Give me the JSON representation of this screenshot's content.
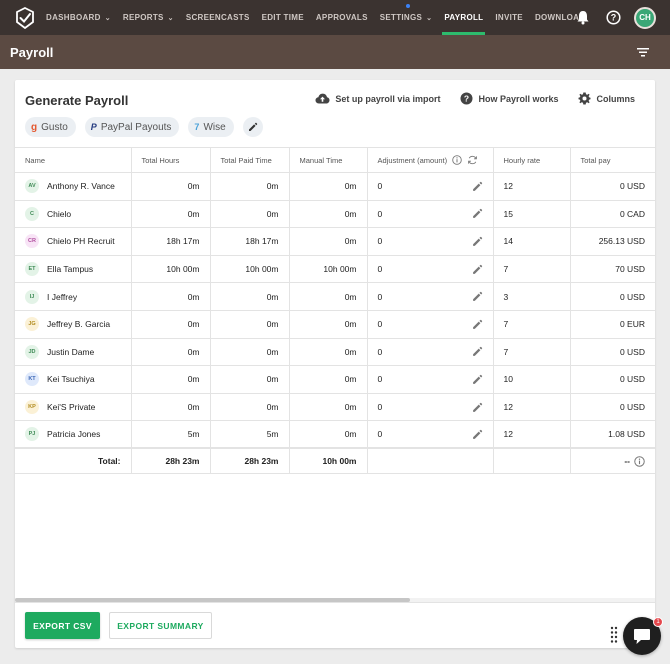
{
  "nav": {
    "items": [
      {
        "label": "DASHBOARD",
        "dropdown": true
      },
      {
        "label": "REPORTS",
        "dropdown": true
      },
      {
        "label": "SCREENCASTS",
        "dropdown": false
      },
      {
        "label": "EDIT TIME",
        "dropdown": false
      },
      {
        "label": "APPROVALS",
        "dropdown": false
      },
      {
        "label": "SETTINGS",
        "dropdown": true
      },
      {
        "label": "PAYROLL",
        "dropdown": false
      },
      {
        "label": "INVITE",
        "dropdown": false
      },
      {
        "label": "DOWNLOAD",
        "dropdown": false
      }
    ],
    "active": "PAYROLL",
    "user_initials": "CH"
  },
  "page": {
    "title": "Payroll"
  },
  "card": {
    "title": "Generate Payroll",
    "actions": {
      "import": "Set up payroll via import",
      "how": "How Payroll works",
      "columns": "Columns"
    },
    "chips": {
      "gusto": "Gusto",
      "paypal": "PayPal Payouts",
      "wise": "Wise"
    }
  },
  "table": {
    "headers": {
      "name": "Name",
      "total_hours": "Total Hours",
      "total_paid": "Total Paid Time",
      "manual": "Manual Time",
      "adjustment": "Adjustment (amount)",
      "hourly": "Hourly rate",
      "total_pay": "Total pay"
    },
    "rows": [
      {
        "initials": "AV",
        "name": "Anthony R. Vance",
        "total_hours": "0m",
        "total_paid": "0m",
        "manual": "0m",
        "adjustment": "0",
        "hourly": "12",
        "total_pay": "0 USD",
        "color": "#e3f3e7",
        "fg": "#3d8a55"
      },
      {
        "initials": "C",
        "name": "Chielo",
        "total_hours": "0m",
        "total_paid": "0m",
        "manual": "0m",
        "adjustment": "0",
        "hourly": "15",
        "total_pay": "0 CAD",
        "color": "#e3f3e7",
        "fg": "#3d8a55"
      },
      {
        "initials": "CR",
        "name": "Chielo PH Recruit",
        "total_hours": "18h 17m",
        "total_paid": "18h 17m",
        "manual": "0m",
        "adjustment": "0",
        "hourly": "14",
        "total_pay": "256.13 USD",
        "color": "#f8e4f6",
        "fg": "#b0509f"
      },
      {
        "initials": "ET",
        "name": "Ella Tampus",
        "total_hours": "10h 00m",
        "total_paid": "10h 00m",
        "manual": "10h 00m",
        "adjustment": "0",
        "hourly": "7",
        "total_pay": "70 USD",
        "color": "#e3f3e7",
        "fg": "#3d8a55"
      },
      {
        "initials": "IJ",
        "name": "I Jeffrey",
        "total_hours": "0m",
        "total_paid": "0m",
        "manual": "0m",
        "adjustment": "0",
        "hourly": "3",
        "total_pay": "0 USD",
        "color": "#e3f3e7",
        "fg": "#3d8a55"
      },
      {
        "initials": "JG",
        "name": "Jeffrey B. Garcia",
        "total_hours": "0m",
        "total_paid": "0m",
        "manual": "0m",
        "adjustment": "0",
        "hourly": "7",
        "total_pay": "0 EUR",
        "color": "#fbf1d6",
        "fg": "#b08a1d"
      },
      {
        "initials": "JD",
        "name": "Justin Dame",
        "total_hours": "0m",
        "total_paid": "0m",
        "manual": "0m",
        "adjustment": "0",
        "hourly": "7",
        "total_pay": "0 USD",
        "color": "#e3f3e7",
        "fg": "#3d8a55"
      },
      {
        "initials": "KT",
        "name": "Kei Tsuchiya",
        "total_hours": "0m",
        "total_paid": "0m",
        "manual": "0m",
        "adjustment": "0",
        "hourly": "10",
        "total_pay": "0 USD",
        "color": "#dfe9fb",
        "fg": "#3b66b5"
      },
      {
        "initials": "KP",
        "name": "Kei'S Private",
        "total_hours": "0m",
        "total_paid": "0m",
        "manual": "0m",
        "adjustment": "0",
        "hourly": "12",
        "total_pay": "0 USD",
        "color": "#fbf1d6",
        "fg": "#b08a1d"
      },
      {
        "initials": "PJ",
        "name": "Patricia Jones",
        "total_hours": "5m",
        "total_paid": "5m",
        "manual": "0m",
        "adjustment": "0",
        "hourly": "12",
        "total_pay": "1.08 USD",
        "color": "#e3f3e7",
        "fg": "#3d8a55"
      }
    ],
    "totals": {
      "label": "Total:",
      "total_hours": "28h 23m",
      "total_paid": "28h 23m",
      "manual": "10h 00m",
      "total_pay": "--"
    }
  },
  "footer": {
    "export_csv": "EXPORT CSV",
    "export_summary": "EXPORT SUMMARY"
  },
  "chat": {
    "badge": "1"
  },
  "colors": {
    "nav_bg": "#3b3330",
    "subheader_bg": "#5b4a42",
    "accent_green": "#1eaa5f"
  }
}
